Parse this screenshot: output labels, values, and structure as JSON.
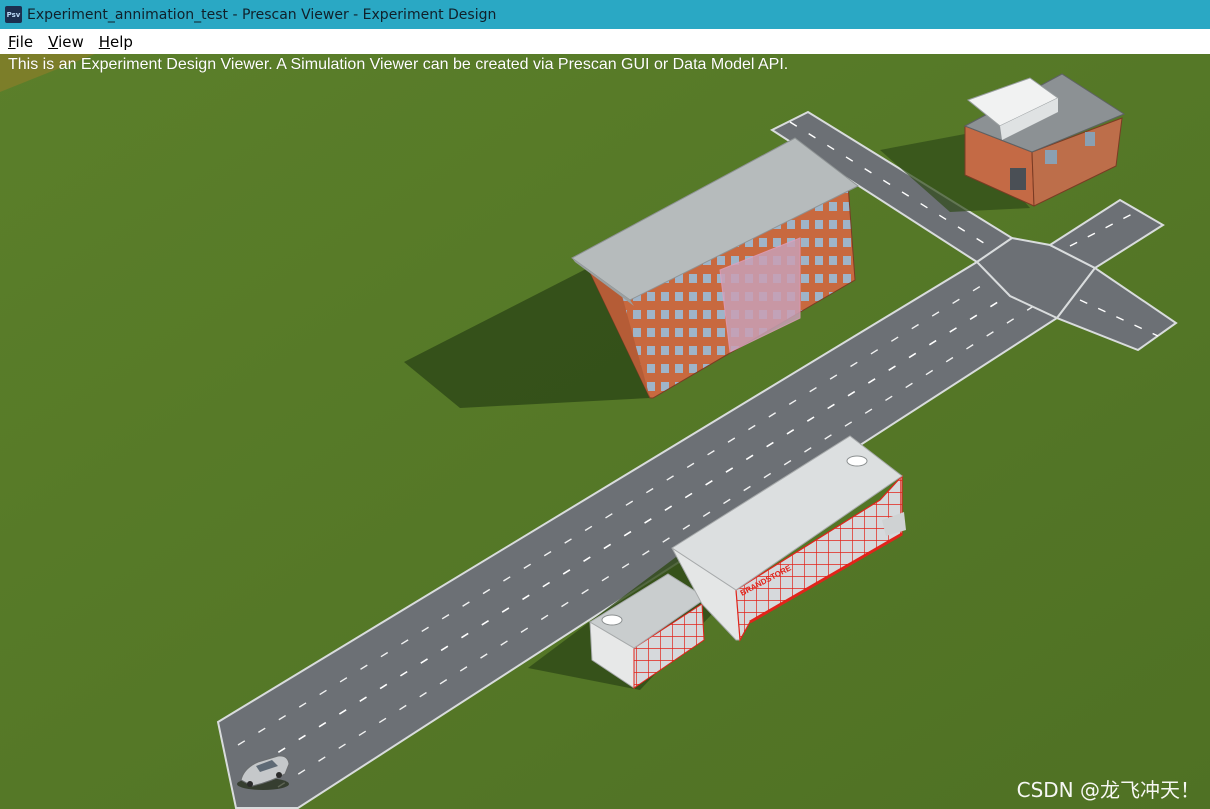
{
  "window": {
    "icon_label": "Psv",
    "title": "Experiment_annimation_test - Prescan Viewer - Experiment Design"
  },
  "menu": {
    "items": [
      {
        "label": "File",
        "mnemonic": "F",
        "rest": "ile"
      },
      {
        "label": "View",
        "mnemonic": "V",
        "rest": "iew"
      },
      {
        "label": "Help",
        "mnemonic": "H",
        "rest": "elp"
      }
    ]
  },
  "viewport": {
    "info_text": "This is an Experiment Design Viewer. A Simulation Viewer can be created via Prescan GUI or Data Model API.",
    "store_sign": "BRANDSTORE",
    "watermark": "CSDN @龙飞冲天！",
    "colors": {
      "grass": "#56792a",
      "road": "#6b6f74",
      "brick": "#c46a45",
      "roof": "#b7bcbd",
      "store_trim": "#e0261f"
    }
  }
}
